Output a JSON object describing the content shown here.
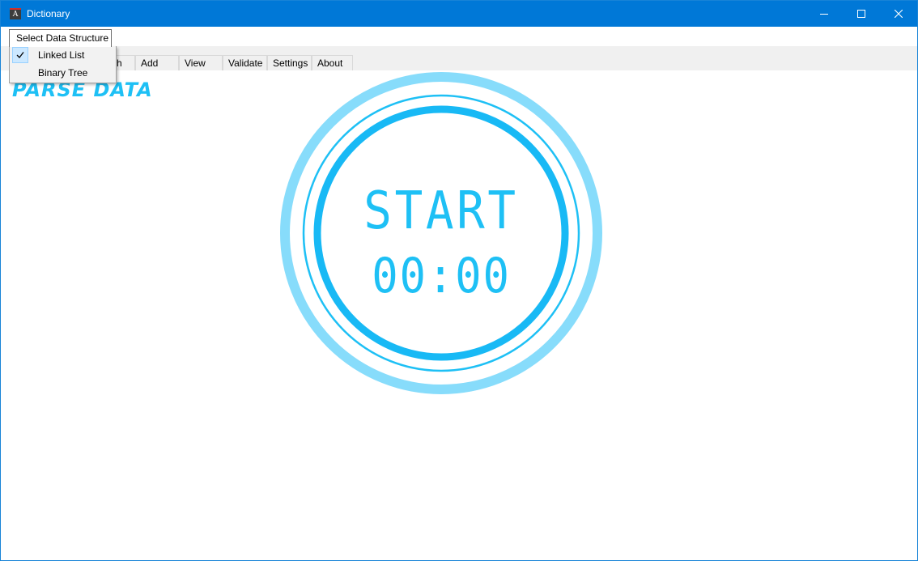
{
  "window": {
    "title": "Dictionary",
    "app_icon_glyph": "A",
    "controls": [
      "minimize-icon",
      "maximize-icon",
      "close-icon"
    ]
  },
  "menu": {
    "open_item": "Select Data Structure",
    "dropdown": {
      "items": [
        {
          "label": "Linked List",
          "checked": true
        },
        {
          "label": "Binary Tree",
          "checked": false
        }
      ]
    }
  },
  "tabs": [
    {
      "label": "Search",
      "visible_text": "ch"
    },
    {
      "label": "Add"
    },
    {
      "label": "View"
    },
    {
      "label": "Validate"
    },
    {
      "label": "Settings"
    },
    {
      "label": "About"
    }
  ],
  "content": {
    "heading": "PARSE DATA",
    "timer": {
      "action_label": "START",
      "time": "00:00"
    }
  },
  "colors": {
    "titlebar": "#0078d7",
    "accent": "#1ec0f5",
    "ring_outer": "#87dcfb",
    "ring_inner": "#18b9f5"
  }
}
